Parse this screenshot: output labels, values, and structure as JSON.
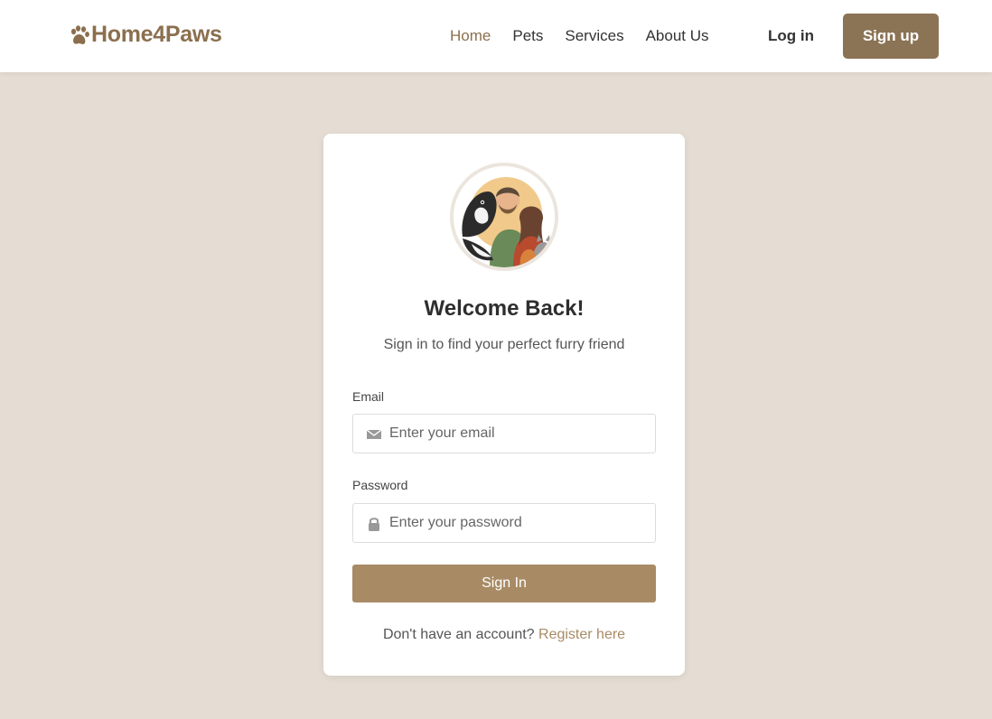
{
  "header": {
    "logo_text": "Home4Paws",
    "nav": [
      {
        "label": "Home",
        "active": true
      },
      {
        "label": "Pets",
        "active": false
      },
      {
        "label": "Services",
        "active": false
      },
      {
        "label": "About Us",
        "active": false
      }
    ],
    "login_label": "Log in",
    "signup_label": "Sign up"
  },
  "card": {
    "title": "Welcome Back!",
    "subtitle": "Sign in to find your perfect furry friend",
    "email": {
      "label": "Email",
      "placeholder": "Enter your email",
      "icon": "envelope-icon"
    },
    "password": {
      "label": "Password",
      "placeholder": "Enter your password",
      "icon": "lock-icon"
    },
    "submit_label": "Sign In",
    "footer_prompt": "Don't have an account?",
    "footer_link": "Register here"
  },
  "colors": {
    "brand": "#8b6f4e",
    "button": "#8b7355",
    "submit": "#a88b65",
    "background": "#e5ddd3"
  }
}
